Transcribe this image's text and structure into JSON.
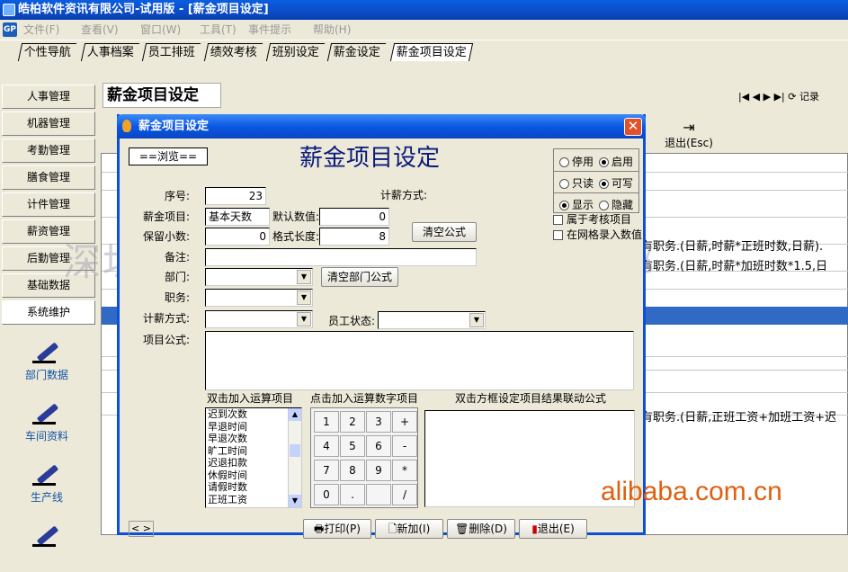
{
  "window": {
    "title": "皓柏软件资讯有限公司-试用版 - [薪金项目设定]"
  },
  "menu": {
    "logo": "GP",
    "items": [
      "文件(F)",
      "查看(V)",
      "窗口(W)",
      "工具(T)",
      "事件提示",
      "帮助(H)"
    ]
  },
  "nav_tabs": [
    "个性导航",
    "人事档案",
    "员工排班",
    "绩效考核",
    "班别设定",
    "薪金设定",
    "薪金项目设定"
  ],
  "sidebar": {
    "buttons": [
      "人事管理",
      "机器管理",
      "考勤管理",
      "膳食管理",
      "计件管理",
      "薪资管理",
      "后勤管理",
      "基础数据",
      "系统维护"
    ],
    "icons": [
      "部门数据",
      "车间资料",
      "生产线"
    ]
  },
  "main": {
    "title": "薪金项目设定",
    "nav_buttons": "|◀ ◀ ▶ ▶| ⟳ 记录",
    "exit_label": "退出(Esc)",
    "grid_texts": [
      "有职务.(日薪,时薪*正班时数,日薪).",
      "有职务.(日薪,时薪*加班时数*1.5,日",
      "有职务.(日薪,正班工资+加班工资+迟"
    ]
  },
  "dialog": {
    "title": "薪金项目设定",
    "mode": "==浏览==",
    "heading": "薪金项目设定",
    "fields": {
      "seq_label": "序号:",
      "seq_value": "23",
      "item_label": "薪金项目:",
      "item_value": "基本天数",
      "default_label": "默认数值:",
      "default_value": "0",
      "decimals_label": "保留小数:",
      "decimals_value": "0",
      "format_label": "格式长度:",
      "format_value": "8",
      "note_label": "备注:",
      "dept_label": "部门:",
      "position_label": "职务:",
      "method_label": "计薪方式:",
      "method_top_label": "计薪方式:",
      "emp_status_label": "员工状态:",
      "formula_label": "项目公式:"
    },
    "buttons": {
      "clear_formula": "清空公式",
      "clear_dept_formula": "清空部门公式"
    },
    "radios": {
      "stop": "停用",
      "enable": "启用",
      "readonly": "只读",
      "writable": "可写",
      "show": "显示",
      "hide": "隐藏"
    },
    "checks": {
      "assess": "属于考核项目",
      "grid_entry": "在网格录入数值"
    },
    "ops_label": "双击加入运算项目",
    "digits_label": "点击加入运算数字项目",
    "result_label": "双击方框设定项目结果联动公式",
    "ops_list": [
      "迟到次数",
      "早退时间",
      "早退次数",
      "旷工时间",
      "迟退扣款",
      "休假时间",
      "请假时数",
      "正班工资"
    ],
    "calc_keys": [
      "1",
      "2",
      "3",
      "+",
      "4",
      "5",
      "6",
      "-",
      "7",
      "8",
      "9",
      "*",
      "0",
      ".",
      "",
      "/"
    ],
    "footer": {
      "nav": "< >",
      "print": "打印(P)",
      "add": "新加(I)",
      "delete": "删除(D)",
      "exit": "退出(E)"
    }
  },
  "watermarks": {
    "center": "深圳市龙岗区龙坤数码通信经营部",
    "corner": "alibaba.com.cn"
  }
}
